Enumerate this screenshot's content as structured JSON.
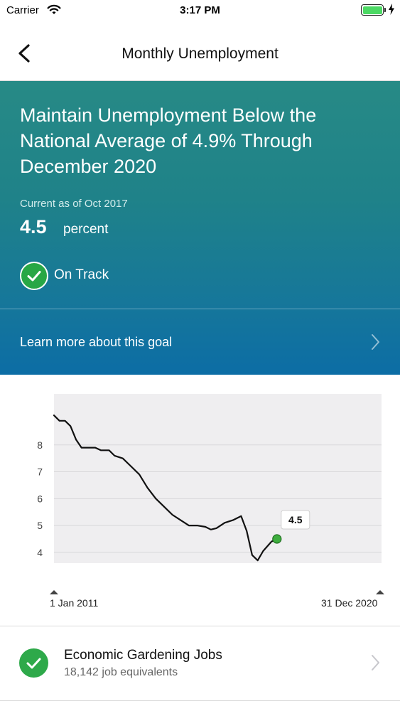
{
  "status_bar": {
    "carrier": "Carrier",
    "time": "3:17 PM",
    "battery_level": 1.0,
    "icons": [
      "wifi-icon",
      "battery-icon",
      "charging-bolt-icon"
    ]
  },
  "nav": {
    "title": "Monthly Unemployment",
    "back_icon": "chevron-left-icon"
  },
  "goal": {
    "title": "Maintain Unemployment Below the National Average of 4.9% Through December 2020",
    "current_label": "Current as of Oct 2017",
    "value": "4.5",
    "unit": "percent",
    "status": "On Track",
    "status_icon": "checkmark-circle-icon",
    "learn_more": "Learn more about this goal",
    "learn_more_icon": "chevron-right-icon"
  },
  "chart_data": {
    "type": "line",
    "y_ticks": [
      "8",
      "7",
      "6",
      "5",
      "4"
    ],
    "y_tick_values": [
      8,
      7,
      6,
      5,
      4
    ],
    "ylim": [
      3.6,
      9.9
    ],
    "x_start_label": "1 Jan 2011",
    "x_end_label": "31 Dec 2020",
    "xlim": [
      "2011-01",
      "2020-12"
    ],
    "grid": true,
    "series": [
      {
        "points": [
          [
            "2011-01",
            9.1
          ],
          [
            "2011-03",
            8.9
          ],
          [
            "2011-05",
            8.9
          ],
          [
            "2011-07",
            8.7
          ],
          [
            "2011-09",
            8.2
          ],
          [
            "2011-11",
            7.9
          ],
          [
            "2012-01",
            7.9
          ],
          [
            "2012-04",
            7.9
          ],
          [
            "2012-06",
            7.8
          ],
          [
            "2012-09",
            7.8
          ],
          [
            "2012-11",
            7.6
          ],
          [
            "2013-02",
            7.5
          ],
          [
            "2013-05",
            7.2
          ],
          [
            "2013-08",
            6.9
          ],
          [
            "2013-11",
            6.4
          ],
          [
            "2014-02",
            6.0
          ],
          [
            "2014-05",
            5.7
          ],
          [
            "2014-08",
            5.4
          ],
          [
            "2014-11",
            5.2
          ],
          [
            "2015-02",
            5.0
          ],
          [
            "2015-05",
            5.0
          ],
          [
            "2015-08",
            4.95
          ],
          [
            "2015-10",
            4.85
          ],
          [
            "2015-12",
            4.9
          ],
          [
            "2016-03",
            5.1
          ],
          [
            "2016-06",
            5.2
          ],
          [
            "2016-09",
            5.35
          ],
          [
            "2016-11",
            4.8
          ],
          [
            "2017-01",
            3.9
          ],
          [
            "2017-03",
            3.7
          ],
          [
            "2017-05",
            4.05
          ],
          [
            "2017-08",
            4.4
          ],
          [
            "2017-10",
            4.5
          ]
        ],
        "color": "#111111"
      }
    ],
    "current_point": {
      "date": "2017-10",
      "value": 4.5,
      "label": "4.5",
      "color": "#3fae3f"
    }
  },
  "measures": [
    {
      "title": "Economic Gardening Jobs",
      "subtitle": "18,142 job equivalents",
      "icon": "checkmark-circle-icon",
      "chevron": "chevron-right-icon"
    }
  ]
}
